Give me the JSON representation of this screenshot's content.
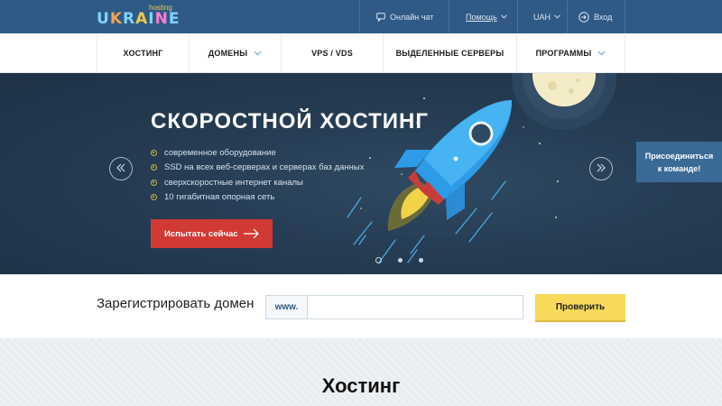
{
  "topbar": {
    "logo": {
      "small": "hosting",
      "letters": [
        "U",
        "K",
        "R",
        "A",
        "I",
        "N",
        "E"
      ]
    },
    "chat_label": "Онлайн чат",
    "help_label": "Помощь",
    "currency_label": "UAH",
    "login_label": "Вход"
  },
  "nav": {
    "items": [
      {
        "label": "ХОСТИНГ",
        "has_dropdown": false
      },
      {
        "label": "ДОМЕНЫ",
        "has_dropdown": true
      },
      {
        "label": "VPS / VDS",
        "has_dropdown": false
      },
      {
        "label": "ВЫДЕЛЕННЫЕ СЕРВЕРЫ",
        "has_dropdown": false
      },
      {
        "label": "ПРОГРАММЫ",
        "has_dropdown": true
      }
    ]
  },
  "hero": {
    "title": "СКОРОСТНОЙ ХОСТИНГ",
    "features": [
      "современное оборудование",
      "SSD на всех веб-серверах и серверах баз данных",
      "сверхскоростные интернет каналы",
      "10 гигабитная опорная сеть"
    ],
    "cta_label": "Испытать сейчас",
    "slides_count": 3,
    "active_slide": 1
  },
  "join_tab": {
    "line1": "Присоединиться",
    "line2": "к команде!"
  },
  "domain": {
    "title": "Зарегистрировать домен",
    "prefix": "www.",
    "input_value": "",
    "input_placeholder": "",
    "check_label": "Проверить"
  },
  "hosting": {
    "title": "Хостинг"
  },
  "colors": {
    "topbar": "#2f5a86",
    "hero_bg": "#253c53",
    "cta": "#d13a34",
    "check_button": "#f7da5a",
    "join_tab": "#3b6a96"
  },
  "icons": [
    "chat-icon",
    "chevron-down-icon",
    "login-icon",
    "arrow-left-icon",
    "arrow-right-icon",
    "long-arrow-icon",
    "rocket-illustration",
    "moon-illustration"
  ]
}
